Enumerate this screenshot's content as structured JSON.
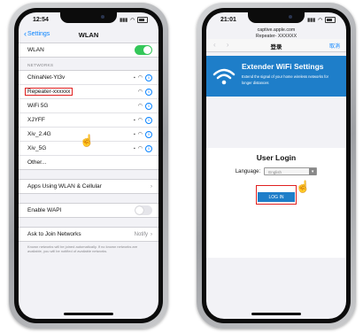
{
  "left_phone": {
    "status": {
      "time": "12:54",
      "carrier_icons": "signal wifi battery"
    },
    "nav": {
      "back_label": "Settings",
      "title": "WLAN"
    },
    "wlan_row": {
      "label": "WLAN",
      "toggle_on": true
    },
    "networks_header": "NETWORKS",
    "networks": [
      {
        "name": "ChinaNet-Yt3v",
        "locked": true
      },
      {
        "name": "Repeater-xxxxxx",
        "locked": false,
        "highlighted": true
      },
      {
        "name": "WiFi 5G",
        "locked": false
      },
      {
        "name": "XJYFF",
        "locked": true
      },
      {
        "name": "Xiv_2.4G",
        "locked": true
      },
      {
        "name": "Xiv_5G",
        "locked": true
      },
      {
        "name": "Other...",
        "locked": false,
        "other": true
      }
    ],
    "apps_row": "Apps Using WLAN & Cellular",
    "wapi_row": {
      "label": "Enable WAPI",
      "toggle_on": false
    },
    "ask_row": {
      "label": "Ask to Join Networks",
      "value": "Notify"
    },
    "footnote": "Known networks will be joined automatically. If no known networks are available, you will be notified of available networks."
  },
  "right_phone": {
    "status": {
      "time": "21:01"
    },
    "url": {
      "domain": "captive.apple.com",
      "ssid": "Repeater- XXXXXX"
    },
    "nav": {
      "title": "登录",
      "cancel": "取消"
    },
    "banner": {
      "title": "Extender WiFi Settings",
      "subtitle": "Extend the signal of your home wireless networks for longer distances"
    },
    "login": {
      "title": "User Login",
      "language_label": "Language:",
      "language_value": "English",
      "button": "LOG IN"
    }
  },
  "colors": {
    "ios_blue": "#0a84ff",
    "switch_green": "#34c759",
    "banner_blue": "#1e7ec9",
    "highlight_red": "#e02020"
  }
}
